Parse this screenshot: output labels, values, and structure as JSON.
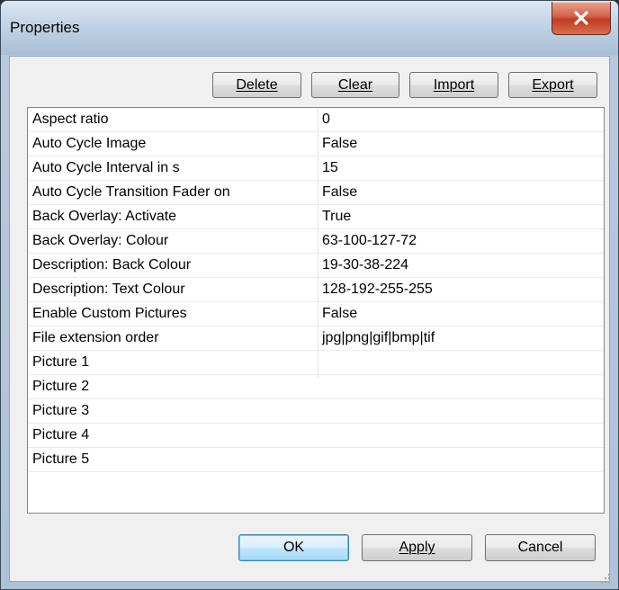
{
  "window": {
    "title": "Properties",
    "close_glyph": "X"
  },
  "toolbar": {
    "buttons": [
      {
        "label": "Delete"
      },
      {
        "label": "Clear"
      },
      {
        "label": "Import"
      },
      {
        "label": "Export"
      }
    ]
  },
  "properties": {
    "rows": [
      {
        "name": "Aspect ratio",
        "value": "0"
      },
      {
        "name": "Auto Cycle Image",
        "value": "False"
      },
      {
        "name": "Auto Cycle Interval in s",
        "value": "15"
      },
      {
        "name": "Auto Cycle Transition Fader on",
        "value": "False"
      },
      {
        "name": "Back Overlay: Activate",
        "value": "True"
      },
      {
        "name": "Back Overlay: Colour",
        "value": "63-100-127-72"
      },
      {
        "name": "Description: Back Colour",
        "value": "19-30-38-224"
      },
      {
        "name": "Description: Text Colour",
        "value": "128-192-255-255"
      },
      {
        "name": "Enable Custom Pictures",
        "value": "False"
      },
      {
        "name": "File extension order",
        "value": "jpg|png|gif|bmp|tif"
      },
      {
        "name": "Picture 1",
        "value": ""
      },
      {
        "name": "Picture 2",
        "value": ""
      },
      {
        "name": "Picture 3",
        "value": ""
      },
      {
        "name": "Picture 4",
        "value": ""
      },
      {
        "name": "Picture 5",
        "value": ""
      }
    ]
  },
  "footer": {
    "ok_label": "OK",
    "apply_label": "Apply",
    "cancel_label": "Cancel"
  },
  "icons": {
    "close": "close-icon",
    "resize_grip": "resize-grip-icon"
  },
  "colors": {
    "close_button": "#c23a22",
    "default_button_border": "#3c7fb1",
    "title_bar": "#c2d3e6"
  }
}
